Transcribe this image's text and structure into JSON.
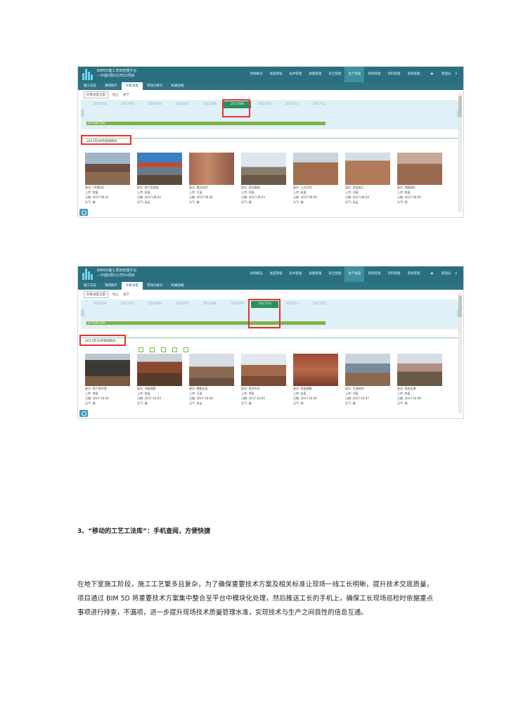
{
  "screens": [
    {
      "brand_line1": "BIM5D施工项目管理平台",
      "brand_line2": "—中建X局X公司XX项目",
      "menu": [
        "项目概况",
        "进度管理",
        "技术管理",
        "质量管理",
        "安全管理",
        "生产进度",
        "现场管理",
        "资料管理",
        "系统管理"
      ],
      "menu_active_index": 5,
      "user_label": "管理员",
      "tabs": [
        "施工日志",
        "现场照片",
        "形象进度",
        "劳动力统计",
        "机械台账"
      ],
      "tabs_active_index": 2,
      "filters": [
        "形象进度全部",
        "地上",
        "地下"
      ],
      "months": [
        "2017/04",
        "2017/05",
        "2017/06",
        "2017/07",
        "2017/08",
        "2017/09",
        "2017/10",
        "2017/11",
        "2017/12"
      ],
      "current_month_index": 5,
      "greenbar_label": "地下室施工阶段",
      "section_title": "2017年09月现场照片",
      "photos": [
        {
          "l1": "部位: 1#楼A区",
          "l2": "上传: 李某",
          "l3": "日期: 2017-09-01",
          "l4": "天气: 晴"
        },
        {
          "l1": "部位: 地下室底板",
          "l2": "上传: 张某",
          "l3": "日期: 2017-09-02",
          "l4": "天气: 多云"
        },
        {
          "l1": "部位: 基坑支护",
          "l2": "上传: 王某",
          "l3": "日期: 2017-09-02",
          "l4": "天气: 晴"
        },
        {
          "l1": "部位: 塔吊基础",
          "l2": "上传: 李某",
          "l3": "日期: 2017-09-03",
          "l4": "天气: 晴"
        },
        {
          "l1": "部位: 土方开挖",
          "l2": "上传: 赵某",
          "l3": "日期: 2017-09-03",
          "l4": "天气: 晴"
        },
        {
          "l1": "部位: 垫层施工",
          "l2": "上传: 刘某",
          "l3": "日期: 2017-09-04",
          "l4": "天气: 多云"
        },
        {
          "l1": "部位: 钢筋绑扎",
          "l2": "上传: 陈某",
          "l3": "日期: 2017-09-04",
          "l4": "天气: 阴"
        }
      ]
    },
    {
      "brand_line1": "BIM5D施工项目管理平台",
      "brand_line2": "—中建X局X公司XX项目",
      "menu": [
        "项目概况",
        "进度管理",
        "技术管理",
        "质量管理",
        "安全管理",
        "生产进度",
        "现场管理",
        "资料管理",
        "系统管理"
      ],
      "menu_active_index": 5,
      "user_label": "管理员",
      "tabs": [
        "施工日志",
        "现场照片",
        "形象进度",
        "劳动力统计",
        "机械台账"
      ],
      "tabs_active_index": 2,
      "filters": [
        "形象进度全部",
        "地上",
        "地下"
      ],
      "months": [
        "2017/04",
        "2017/05",
        "2017/06",
        "2017/07",
        "2017/08",
        "2017/09",
        "2017/10",
        "2017/11",
        "2017/12"
      ],
      "current_month_index": 6,
      "greenbar_label": "地下室施工阶段",
      "section_title": "2017年10月现场照片",
      "photos": [
        {
          "l1": "部位: 地下室外墙",
          "l2": "上传: 李某",
          "l3": "日期: 2017-10-02",
          "l4": "天气: 晴"
        },
        {
          "l1": "部位: 顶板钢筋",
          "l2": "上传: 张某",
          "l3": "日期: 2017-10-03",
          "l4": "天气: 晴"
        },
        {
          "l1": "部位: 模板支设",
          "l2": "上传: 王某",
          "l3": "日期: 2017-10-04",
          "l4": "天气: 多云"
        },
        {
          "l1": "部位: 塔吊作业",
          "l2": "上传: 李某",
          "l3": "日期: 2017-10-05",
          "l4": "天气: 晴"
        },
        {
          "l1": "部位: 底板钢筋",
          "l2": "上传: 赵某",
          "l3": "日期: 2017-10-06",
          "l4": "天气: 阴"
        },
        {
          "l1": "部位: 主体结构",
          "l2": "上传: 刘某",
          "l3": "日期: 2017-10-07",
          "l4": "天气: 晴"
        },
        {
          "l1": "部位: 现场全景",
          "l2": "上传: 陈某",
          "l3": "日期: 2017-10-08",
          "l4": "天气: 晴"
        }
      ]
    }
  ],
  "heading": "3、“移动的工艺工法库”：手机查阅，方便快捷",
  "paragraph": "在地下室施工阶段，施工工艺繁多且复杂，为了确保重要技术方案及相关标准让现场一线工长明晰，提升技术交底质量，项目通过 BIM 5D 将重要技术方案集中整合至平台中模块化处理，然后推送工长的手机上，确保工长现场巡检时依据重点事项进行排查，不漏项，进一步提升现场技术质量管理水准，实现技术与生产之间良性的信息互通。",
  "colors": {
    "topbar": "#2a6f7f",
    "current_month": "#2a8f5f",
    "highlight_box": "#e53232",
    "progress_bar": "#7fb34a"
  },
  "icons": [
    "app-logo-icon",
    "user-avatar-icon",
    "timeline-left-arrow-icon",
    "timeline-right-arrow-icon",
    "refresh-icon"
  ]
}
